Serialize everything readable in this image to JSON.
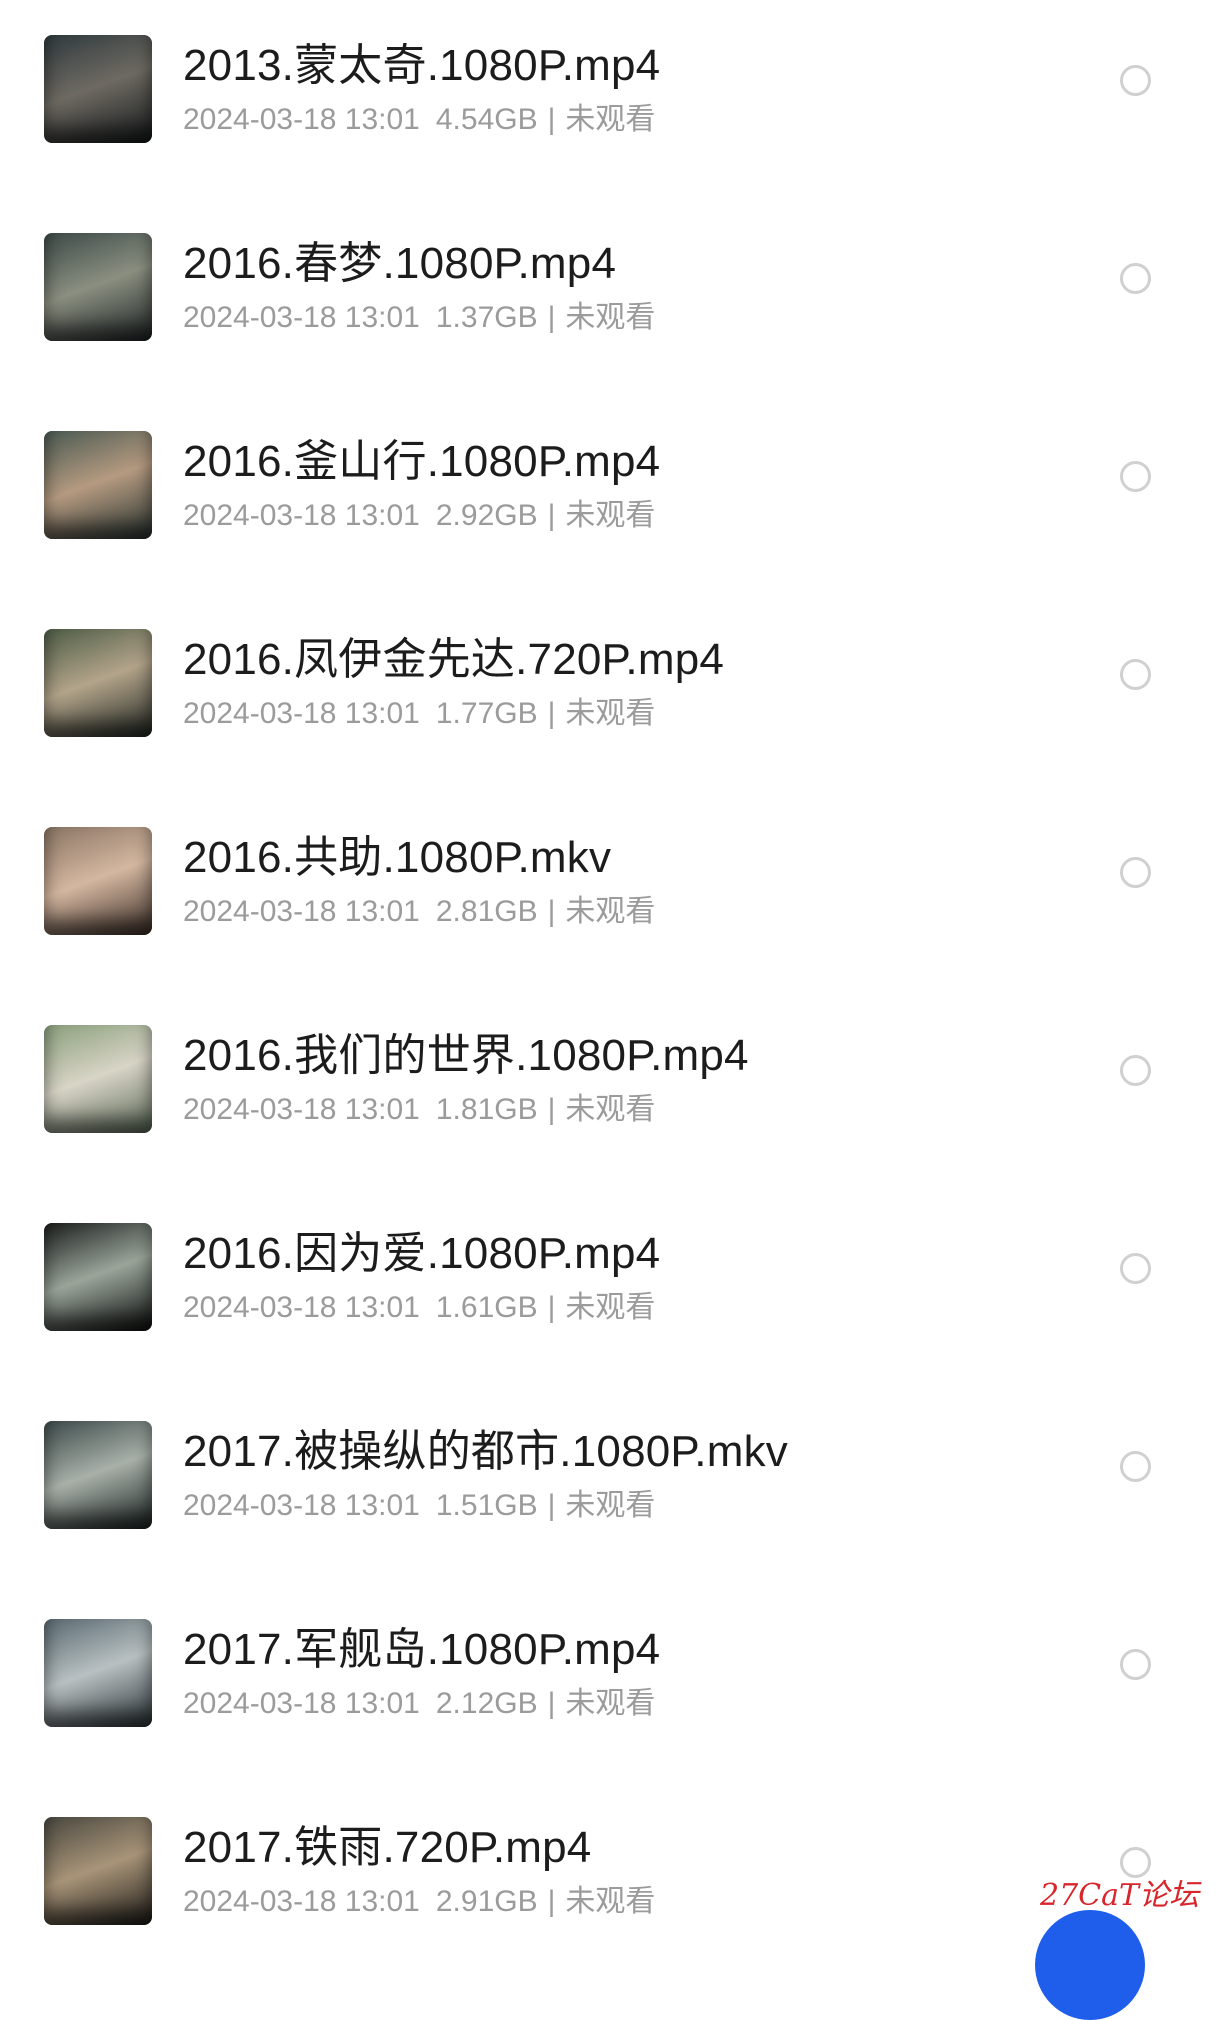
{
  "files": [
    {
      "title": "2013.蒙太奇.1080P.mp4",
      "date": "2024-03-18 13:01",
      "size": "4.54GB",
      "sep": "|",
      "status": "未观看",
      "thumb_colors": [
        "#2f3a3e",
        "#6e6a62",
        "#14181a"
      ]
    },
    {
      "title": "2016.春梦.1080P.mp4",
      "date": "2024-03-18 13:01",
      "size": "1.37GB",
      "sep": "|",
      "status": "未观看",
      "thumb_colors": [
        "#3d4a48",
        "#8a8f80",
        "#1e2426"
      ]
    },
    {
      "title": "2016.釜山行.1080P.mp4",
      "date": "2024-03-18 13:01",
      "size": "2.92GB",
      "sep": "|",
      "status": "未观看",
      "thumb_colors": [
        "#4a5a52",
        "#b59a80",
        "#273330"
      ]
    },
    {
      "title": "2016.凤伊金先达.720P.mp4",
      "date": "2024-03-18 13:01",
      "size": "1.77GB",
      "sep": "|",
      "status": "未观看",
      "thumb_colors": [
        "#4d5c46",
        "#b3a48a",
        "#202622"
      ]
    },
    {
      "title": "2016.共助.1080P.mkv",
      "date": "2024-03-18 13:01",
      "size": "2.81GB",
      "sep": "|",
      "status": "未观看",
      "thumb_colors": [
        "#8a7564",
        "#d4b7a0",
        "#3b2e27"
      ]
    },
    {
      "title": "2016.我们的世界.1080P.mp4",
      "date": "2024-03-18 13:01",
      "size": "1.81GB",
      "sep": "|",
      "status": "未观看",
      "thumb_colors": [
        "#8aa07c",
        "#d8d4c6",
        "#5b6a58"
      ]
    },
    {
      "title": "2016.因为爱.1080P.mp4",
      "date": "2024-03-18 13:01",
      "size": "1.61GB",
      "sep": "|",
      "status": "未观看",
      "thumb_colors": [
        "#1a1d1c",
        "#9aa59a",
        "#0c0e0d"
      ]
    },
    {
      "title": "2017.被操纵的都市.1080P.mkv",
      "date": "2024-03-18 13:01",
      "size": "1.51GB",
      "sep": "|",
      "status": "未观看",
      "thumb_colors": [
        "#3c4a4a",
        "#a8b0a8",
        "#1a2222"
      ]
    },
    {
      "title": "2017.军舰岛.1080P.mp4",
      "date": "2024-03-18 13:01",
      "size": "2.12GB",
      "sep": "|",
      "status": "未观看",
      "thumb_colors": [
        "#5a6a70",
        "#b8c0c2",
        "#2a3236"
      ]
    },
    {
      "title": "2017.铁雨.720P.mp4",
      "date": "2024-03-18 13:01",
      "size": "2.91GB",
      "sep": "|",
      "status": "未观看",
      "thumb_colors": [
        "#4a4840",
        "#a89478",
        "#1e1c18"
      ]
    }
  ],
  "watermark": "27CaT论坛",
  "colors": {
    "title": "#1c1c1c",
    "meta": "#9b9b9b",
    "radio_border": "#d0d0d0",
    "fab": "#1f5eea",
    "watermark": "#d8262c"
  },
  "icons": {
    "select": "radio-circle",
    "fab": "floating-action-button"
  }
}
